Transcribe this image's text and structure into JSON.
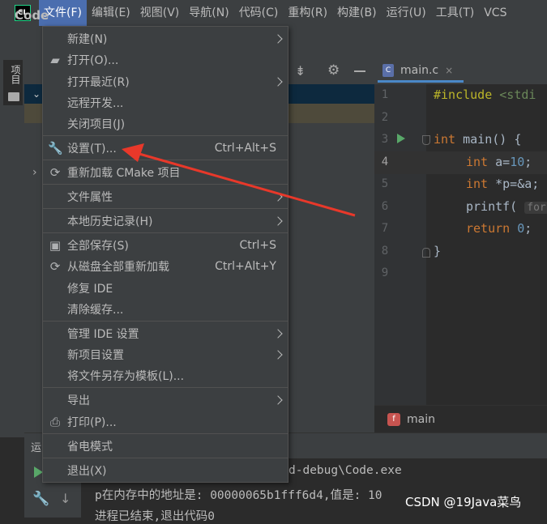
{
  "menubar": {
    "logo": "CL",
    "items": [
      "文件(F)",
      "编辑(E)",
      "视图(V)",
      "导航(N)",
      "代码(C)",
      "重构(R)",
      "构建(B)",
      "运行(U)",
      "工具(T)",
      "VCS"
    ]
  },
  "project": {
    "title": "Code",
    "strip_label": "项目"
  },
  "file_menu": {
    "new": "新建(N)",
    "open": "打开(O)...",
    "open_recent": "打开最近(R)",
    "remote_dev": "远程开发...",
    "close_project": "关闭项目(J)",
    "settings": "设置(T)...",
    "settings_shortcut": "Ctrl+Alt+S",
    "reload_cmake": "重新加载 CMake 项目",
    "file_properties": "文件属性",
    "local_history": "本地历史记录(H)",
    "save_all": "全部保存(S)",
    "save_all_shortcut": "Ctrl+S",
    "reload_all": "从磁盘全部重新加载",
    "reload_all_shortcut": "Ctrl+Alt+Y",
    "repair_ide": "修复 IDE",
    "clear_cache": "清除缓存...",
    "manage_ide_settings": "管理 IDE 设置",
    "new_project_settings": "新项目设置",
    "save_as_template": "将文件另存为模板(L)...",
    "export": "导出",
    "print": "打印(P)...",
    "power_save": "省电模式",
    "exit": "退出(X)"
  },
  "editor": {
    "tab": "main.c",
    "tab_icon": "C",
    "line_numbers": [
      "1",
      "2",
      "3",
      "4",
      "5",
      "6",
      "7",
      "8",
      "9"
    ],
    "code": {
      "l1_kw": "#include",
      "l1_rest": " <stdi",
      "l3_kw": "int",
      "l3_rest": " main() {",
      "l4_kw": "int",
      "l4_rest": " a=",
      "l4_num": "10",
      "l4_end": ";",
      "l5_kw": "int",
      "l5_rest": " *p=&a;",
      "l6_fn": "printf(",
      "l6_hint": "for",
      "l7_kw": "return",
      "l7_num": "0",
      "l7_end": ";",
      "l8": "}"
    },
    "breadcrumb": "main"
  },
  "run_panel": {
    "label": "运",
    "lines": [
      "d-debug\\Code.exe",
      "p在内存中的地址是: 00000065b1fff6d4,值是: 10",
      "进程已结束,退出代码0"
    ]
  },
  "watermark": "CSDN @19Java菜鸟",
  "colors": {
    "accent": "#4b6eaf",
    "arrow": "#e8382a"
  }
}
